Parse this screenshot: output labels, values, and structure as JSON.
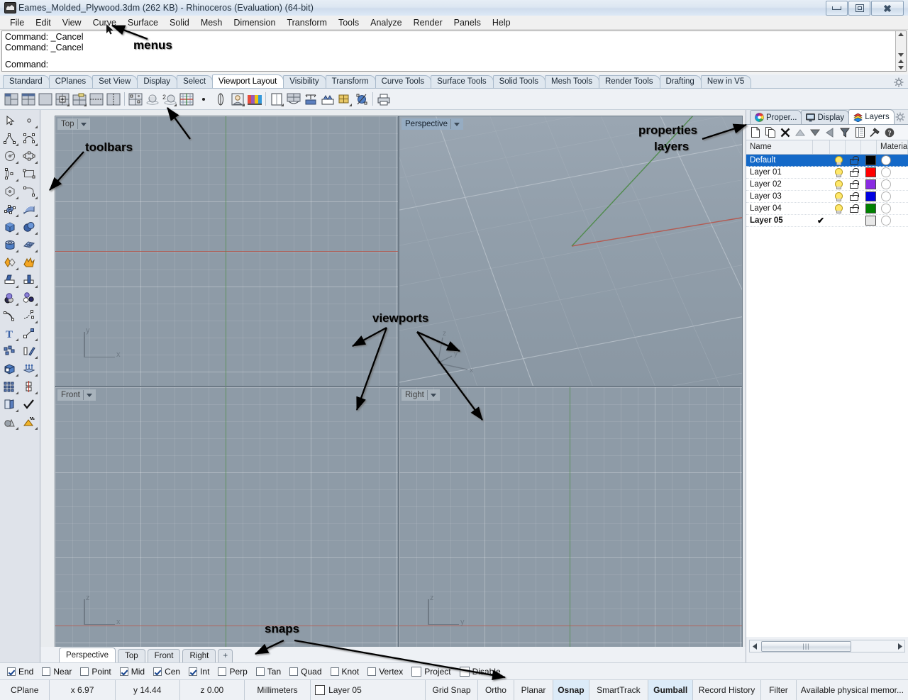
{
  "window": {
    "title": "Eames_Molded_Plywood.3dm (262 KB) - Rhinoceros (Evaluation) (64-bit)",
    "app_icon": "rhino-icon",
    "minimize_label": "minimize-icon",
    "restore_label": "restore-icon",
    "close_label": "close-icon"
  },
  "menubar": {
    "items": [
      "File",
      "Edit",
      "View",
      "Curve",
      "Surface",
      "Solid",
      "Mesh",
      "Dimension",
      "Transform",
      "Tools",
      "Analyze",
      "Render",
      "Panels",
      "Help"
    ]
  },
  "command_area": {
    "history": [
      "Command: _Cancel",
      "Command: _Cancel"
    ],
    "prompt": "Command:",
    "input_value": ""
  },
  "toolbar_tabs": {
    "items": [
      "Standard",
      "CPlanes",
      "Set View",
      "Display",
      "Select",
      "Viewport Layout",
      "Visibility",
      "Transform",
      "Curve Tools",
      "Surface Tools",
      "Solid Tools",
      "Mesh Tools",
      "Render Tools",
      "Drafting",
      "New in V5"
    ],
    "active": "Viewport Layout",
    "options_icon": "gear-icon"
  },
  "toolbar_buttons": [
    {
      "name": "viewport-layout-3-split-icon"
    },
    {
      "name": "viewport-layout-4-split-icon"
    },
    {
      "name": "viewport-layout-single-icon"
    },
    {
      "name": "new-viewport-icon"
    },
    {
      "name": "copy-viewport-icon"
    },
    {
      "name": "split-viewport-horizontal-icon"
    },
    {
      "name": "split-viewport-vertical-icon"
    },
    {
      "sep": true
    },
    {
      "name": "four-view-icon"
    },
    {
      "name": "shaded-viewport-icon"
    },
    {
      "name": "two-shaded-viewports-icon"
    },
    {
      "name": "grid-options-icon"
    },
    {
      "name": "point-icon"
    },
    {
      "name": "camera-lens-icon"
    },
    {
      "name": "named-view-icon"
    },
    {
      "name": "wallpaper-icon"
    },
    {
      "sep": true
    },
    {
      "name": "page-layout-icon"
    },
    {
      "name": "tile-viewports-icon"
    },
    {
      "name": "maximize-viewport-icon"
    },
    {
      "name": "restore-viewport-icon"
    },
    {
      "name": "synchronize-viewports-icon"
    },
    {
      "name": "zoom-extents-icon"
    },
    {
      "sep": true
    },
    {
      "name": "print-icon"
    }
  ],
  "left_toolbar": [
    [
      "select-objects-icon",
      "point-object-icon"
    ],
    [
      "polyline-icon",
      "control-point-curve-icon"
    ],
    [
      "circle-icon",
      "ellipse-icon"
    ],
    [
      "arc-icon",
      "rectangle-icon"
    ],
    [
      "polygon-icon",
      "curve-fillet-icon"
    ],
    [
      "surface-from-points-icon",
      "surface-from-curve-icon"
    ],
    [
      "box-icon",
      "sphere-icon"
    ],
    [
      "cylinder-icon",
      "surface-edit-icon"
    ],
    [
      "boolean-union-icon",
      "explode-icon"
    ],
    [
      "trim-icon",
      "split-icon"
    ],
    [
      "offset-icon",
      "array-icon"
    ],
    [
      "fillet-curve-icon",
      "blend-curve-icon"
    ],
    [
      "text-icon",
      "dimension-icon"
    ],
    [
      "group-icon",
      "mirror-icon"
    ],
    [
      "solid-tools-icon",
      "extrude-icon"
    ],
    [
      "rectangular-array-icon",
      "analyze-icon"
    ],
    [
      "layer-tools-icon",
      "check-icon"
    ],
    [
      "shade-icon",
      "render-icon"
    ]
  ],
  "viewports": [
    {
      "name": "Top",
      "active": false,
      "position": "top-left",
      "axes": [
        "y",
        "x"
      ]
    },
    {
      "name": "Perspective",
      "active": true,
      "position": "top-right",
      "axes": [
        "z",
        "y",
        "x"
      ]
    },
    {
      "name": "Front",
      "active": false,
      "position": "bottom-left",
      "axes": [
        "z",
        "x"
      ]
    },
    {
      "name": "Right",
      "active": false,
      "position": "bottom-right",
      "axes": [
        "z",
        "y"
      ]
    }
  ],
  "annotations": [
    {
      "id": "menus",
      "text": "menus"
    },
    {
      "id": "toolbars",
      "text": "toolbars"
    },
    {
      "id": "properties-layers",
      "line1": "properties",
      "line2": "layers"
    },
    {
      "id": "viewports",
      "text": "viewports"
    },
    {
      "id": "snaps",
      "text": "snaps"
    }
  ],
  "panel": {
    "tabs": [
      {
        "label": "Proper...",
        "icon": "color-wheel-icon",
        "active": false
      },
      {
        "label": "Display",
        "icon": "monitor-icon",
        "active": false
      },
      {
        "label": "Layers",
        "icon": "layers-icon",
        "active": true
      }
    ],
    "options_icon": "gear-icon",
    "toolbar": [
      {
        "name": "new-layer-icon"
      },
      {
        "name": "copy-layer-icon"
      },
      {
        "name": "delete-layer-icon"
      },
      {
        "name": "move-layer-up-icon"
      },
      {
        "name": "move-layer-down-icon"
      },
      {
        "name": "previous-layer-icon"
      },
      {
        "name": "filter-icon"
      },
      {
        "name": "layer-properties-icon"
      },
      {
        "name": "layer-tools-icon"
      },
      {
        "name": "help-icon"
      }
    ],
    "columns": [
      "Name",
      "",
      "",
      "",
      "",
      "Material"
    ],
    "layers": [
      {
        "name": "Default",
        "current": false,
        "on": true,
        "locked": false,
        "color": "#000000",
        "selected": true,
        "bold": false
      },
      {
        "name": "Layer 01",
        "current": false,
        "on": true,
        "locked": false,
        "color": "#ff0000",
        "selected": false,
        "bold": false
      },
      {
        "name": "Layer 02",
        "current": false,
        "on": true,
        "locked": false,
        "color": "#8a2be2",
        "selected": false,
        "bold": false
      },
      {
        "name": "Layer 03",
        "current": false,
        "on": true,
        "locked": false,
        "color": "#0000e0",
        "selected": false,
        "bold": false
      },
      {
        "name": "Layer 04",
        "current": false,
        "on": true,
        "locked": false,
        "color": "#008000",
        "selected": false,
        "bold": false
      },
      {
        "name": "Layer 05",
        "current": true,
        "on": false,
        "locked": false,
        "color": "#e8e8e8",
        "selected": false,
        "bold": true
      }
    ],
    "scrollbar": {
      "left_arrow": "scroll-left-icon",
      "right_arrow": "scroll-right-icon",
      "grip": "|||"
    }
  },
  "viewport_tabs": {
    "items": [
      "Perspective",
      "Top",
      "Front",
      "Right"
    ],
    "active": "Perspective",
    "add_label": "+"
  },
  "osnaps": [
    {
      "label": "End",
      "checked": true
    },
    {
      "label": "Near",
      "checked": false
    },
    {
      "label": "Point",
      "checked": false
    },
    {
      "label": "Mid",
      "checked": true
    },
    {
      "label": "Cen",
      "checked": true
    },
    {
      "label": "Int",
      "checked": true
    },
    {
      "label": "Perp",
      "checked": false
    },
    {
      "label": "Tan",
      "checked": false
    },
    {
      "label": "Quad",
      "checked": false
    },
    {
      "label": "Knot",
      "checked": false
    },
    {
      "label": "Vertex",
      "checked": false
    },
    {
      "label": "Project",
      "checked": false
    },
    {
      "label": "Disable",
      "checked": false
    }
  ],
  "statusbar": {
    "cplane": "CPlane",
    "x": "x 6.97",
    "y": "y 14.44",
    "z": "z 0.00",
    "units": "Millimeters",
    "layer": "Layer 05",
    "toggles": [
      {
        "label": "Grid Snap",
        "on": false
      },
      {
        "label": "Ortho",
        "on": false
      },
      {
        "label": "Planar",
        "on": false
      },
      {
        "label": "Osnap",
        "on": true
      },
      {
        "label": "SmartTrack",
        "on": false
      },
      {
        "label": "Gumball",
        "on": true
      },
      {
        "label": "Record History",
        "on": false
      },
      {
        "label": "Filter",
        "on": false
      }
    ],
    "memory": "Available physical memor..."
  },
  "colors": {
    "accent": "#1469c8",
    "viewport_bg": "#8e9ba7",
    "axis_x": "#b5584e",
    "axis_y": "#4e8a4a",
    "titlebar": "#dde7f2"
  }
}
